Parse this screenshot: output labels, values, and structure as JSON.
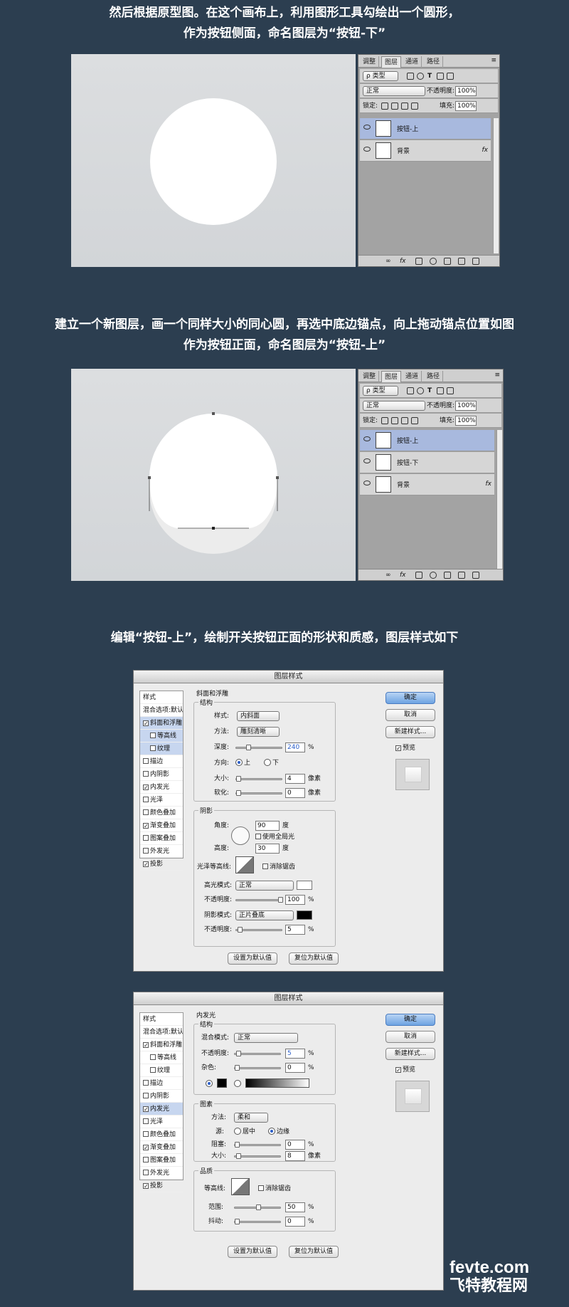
{
  "captions": {
    "s1_line1": "然后根据原型图。在这个画布上，利用图形工具勾绘出一个圆形，",
    "s1_line2": "作为按钮侧面，命名图层为“按钮-下”",
    "s2_line1": "建立一个新图层，画一个同样大小的同心圆，再选中底边锚点，向上拖动锚点位置如图",
    "s2_line2": "作为按钮正面，命名图层为“按钮-上”",
    "s3_line1": "编辑“按钮-上”，绘制开关按钮正面的形状和质感，图层样式如下"
  },
  "panel": {
    "tabs": [
      "调整",
      "图层",
      "通道",
      "路径"
    ],
    "kind_label": "ρ 类型",
    "blend": "正常",
    "opacity_label": "不透明度:",
    "opacity": "100%",
    "lock_label": "锁定:",
    "fill_label": "填充:",
    "fill": "100%",
    "fx": "fx",
    "p1_layers": [
      "按钮-上",
      "背景"
    ],
    "p2_layers": [
      "按钮-上",
      "按钮-下",
      "背景"
    ]
  },
  "dialog1": {
    "title": "图层样式",
    "styles_header": "样式",
    "blend_default": "混合选项:默认",
    "items": [
      "斜面和浮雕",
      "等高线",
      "纹理",
      "描边",
      "内阴影",
      "内发光",
      "光泽",
      "颜色叠加",
      "渐变叠加",
      "图案叠加",
      "外发光",
      "投影"
    ],
    "ok": "确定",
    "cancel": "取消",
    "new_style": "新建样式...",
    "preview": "预览",
    "section": "斜面和浮雕",
    "structure": "结构",
    "style_label": "样式:",
    "style_val": "内斜面",
    "method_label": "方法:",
    "method_val": "雕刻清晰",
    "depth_label": "深度:",
    "depth": "240",
    "pct": "%",
    "dir_label": "方向:",
    "dir_up": "上",
    "dir_down": "下",
    "size_label": "大小:",
    "size": "4",
    "px": "像素",
    "soften_label": "软化:",
    "soften": "0",
    "shading": "阴影",
    "angle_label": "角度:",
    "angle": "90",
    "deg": "度",
    "global_light": "使用全局光",
    "altitude_label": "高度:",
    "altitude": "30",
    "gloss_label": "光泽等高线:",
    "antialias": "消除锯齿",
    "hl_mode_label": "高光模式:",
    "hl_mode": "正常",
    "hl_opacity_label": "不透明度:",
    "hl_opacity": "100",
    "sh_mode_label": "阴影模式:",
    "sh_mode": "正片叠底",
    "sh_opacity_label": "不透明度:",
    "sh_opacity": "5",
    "make_default": "设置为默认值",
    "reset_default": "复位为默认值"
  },
  "dialog2": {
    "title": "图层样式",
    "section": "内发光",
    "structure": "结构",
    "blend_mode_label": "混合模式:",
    "blend_mode": "正常",
    "opacity_label": "不透明度:",
    "opacity": "5",
    "noise_label": "杂色:",
    "noise": "0",
    "pct": "%",
    "elements": "图素",
    "method_label": "方法:",
    "method_val": "柔和",
    "source_label": "源:",
    "src_center": "居中",
    "src_edge": "边缘",
    "choke_label": "阻塞:",
    "choke": "0",
    "size_label": "大小:",
    "size": "8",
    "px": "像素",
    "quality": "品质",
    "contour_label": "等高线:",
    "antialias": "消除锯齿",
    "range_label": "范围:",
    "range": "50",
    "jitter_label": "抖动:",
    "jitter": "0",
    "make_default": "设置为默认值",
    "reset_default": "复位为默认值"
  },
  "watermark": {
    "brand": "fevte.com",
    "cn": "飞特教程网"
  },
  "colors": {
    "bg": "#2c3e50",
    "active_layer": "#a8b9de",
    "ok_button": "#6ea3e2"
  }
}
